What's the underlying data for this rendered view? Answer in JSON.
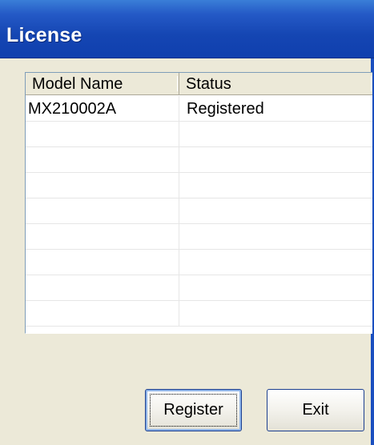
{
  "window": {
    "title": "License"
  },
  "license_table": {
    "columns": [
      "Model Name",
      "Status"
    ],
    "rows": [
      {
        "model_name": "MX210002A",
        "status": "Registered"
      },
      {
        "model_name": "",
        "status": ""
      },
      {
        "model_name": "",
        "status": ""
      },
      {
        "model_name": "",
        "status": ""
      },
      {
        "model_name": "",
        "status": ""
      },
      {
        "model_name": "",
        "status": ""
      },
      {
        "model_name": "",
        "status": ""
      },
      {
        "model_name": "",
        "status": ""
      },
      {
        "model_name": "",
        "status": ""
      }
    ]
  },
  "buttons": {
    "register_label": "Register",
    "exit_label": "Exit"
  },
  "colors": {
    "titlebar": "#1546b3",
    "client_background": "#ece9d8",
    "button_border": "#1c3f8f"
  }
}
